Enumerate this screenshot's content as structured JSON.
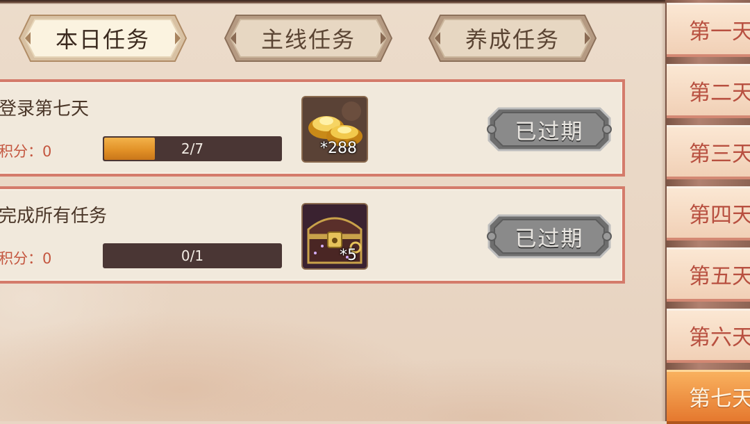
{
  "tabs": [
    {
      "label": "本日任务",
      "active": true
    },
    {
      "label": "主线任务",
      "active": false
    },
    {
      "label": "养成任务",
      "active": false
    }
  ],
  "tasks": [
    {
      "title": "登录第七天",
      "score": "积分：0",
      "progress_text": "2/7",
      "progress_fraction": 0.2857,
      "reward_icon": "gold-ingot-icon",
      "reward_count": "*288",
      "status_label": "已过期"
    },
    {
      "title": "完成所有任务",
      "score": "积分：0",
      "progress_text": "0/1",
      "progress_fraction": 0,
      "reward_icon": "treasure-chest-icon",
      "reward_count": "*5",
      "status_label": "已过期"
    }
  ],
  "days": [
    {
      "label": "第一天",
      "active": false
    },
    {
      "label": "第二天",
      "active": false
    },
    {
      "label": "第三天",
      "active": false
    },
    {
      "label": "第四天",
      "active": false
    },
    {
      "label": "第五天",
      "active": false
    },
    {
      "label": "第六天",
      "active": false
    },
    {
      "label": "第七天",
      "active": true
    }
  ],
  "colors": {
    "task_border": "#d47b6b",
    "score_text": "#c4563f",
    "progress_fill": "#e08f25",
    "day_active": "#e5782e",
    "day_text": "#b85040"
  }
}
